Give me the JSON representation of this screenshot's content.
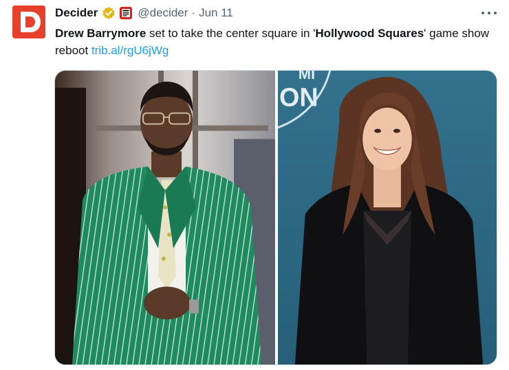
{
  "tweet": {
    "avatar_letter": "D",
    "author_name": "Decider",
    "handle": "@decider",
    "separator": "·",
    "date": "Jun 11",
    "text": {
      "bold_1": "Drew Barrymore",
      "plain_1": " set to take the center square in '",
      "bold_2": "Hollywood Squares",
      "plain_2": "' game show reboot ",
      "link": "trib.al/rgU6jWg"
    },
    "affiliate_badge_text": "NY POST"
  },
  "colors": {
    "avatar_bg": "#e8412b",
    "verified": "#e2b719",
    "link": "#1d9bf0",
    "muted": "#536471",
    "right_photo_bg": "#2e6b86",
    "left_suit": "#1f8a5e"
  },
  "icons": {
    "verified": "verified-badge-icon",
    "more": "more-icon",
    "affiliate": "nypost-icon"
  }
}
